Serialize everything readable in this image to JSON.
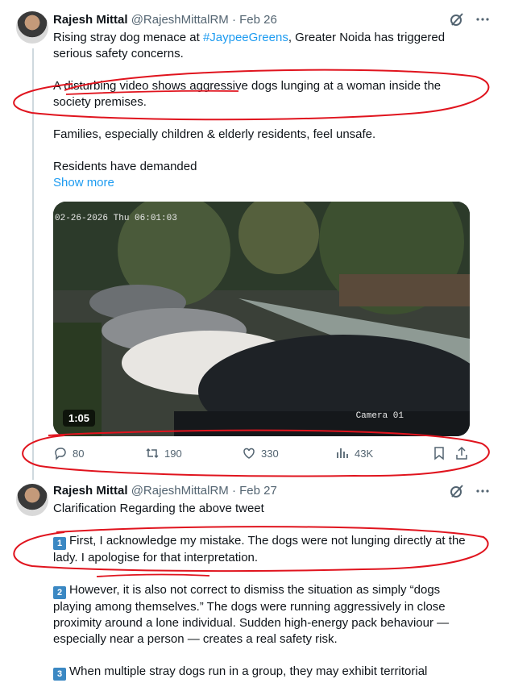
{
  "tweet1": {
    "name": "Rajesh Mittal",
    "handle": "@RajeshMittalRM",
    "dot": "·",
    "date": "Feb 26",
    "text_pre": "Rising stray dog menace at ",
    "hashtag": "#JaypeeGreens",
    "text_post": ", Greater Noida has triggered serious safety concerns.",
    "para2": "A disturbing video shows aggressive dogs lunging at a woman inside the society premises.",
    "para3": "Families, especially children & elderly residents, feel unsafe.",
    "para4": "Residents have demanded",
    "show_more": "Show more",
    "video": {
      "timestamp": "02-26-2026 Thu 06:01:03",
      "camera": "Camera 01",
      "duration": "1:05"
    },
    "stats": {
      "replies": "80",
      "retweets": "190",
      "likes": "330",
      "views": "43K"
    }
  },
  "tweet2": {
    "name": "Rajesh Mittal",
    "handle": "@RajeshMittalRM",
    "dot": "·",
    "date": "Feb 27",
    "title": "Clarification Regarding the above tweet",
    "p1_num": "1",
    "p1": "First, I acknowledge my mistake. The dogs were not lunging directly at the lady. I apologise for that interpretation.",
    "p2_num": "2",
    "p2": "However, it is also not correct to dismiss the situation as simply “dogs playing among themselves.” The dogs were running aggressively in close proximity around a lone individual. Sudden high-energy pack behaviour — especially near a person — creates a real safety risk.",
    "p3_num": "3",
    "p3": "When multiple stray dogs run in a group, they may exhibit territorial"
  },
  "icons": {
    "grok": "grok-slash-icon",
    "more": "more-dots-icon",
    "reply": "reply-icon",
    "retweet": "retweet-icon",
    "like": "like-heart-icon",
    "views": "views-chart-icon",
    "bookmark": "bookmark-icon",
    "share": "share-icon"
  },
  "colors": {
    "link": "#1d9bf0",
    "annotation": "#e0141e",
    "muted": "#536471"
  }
}
